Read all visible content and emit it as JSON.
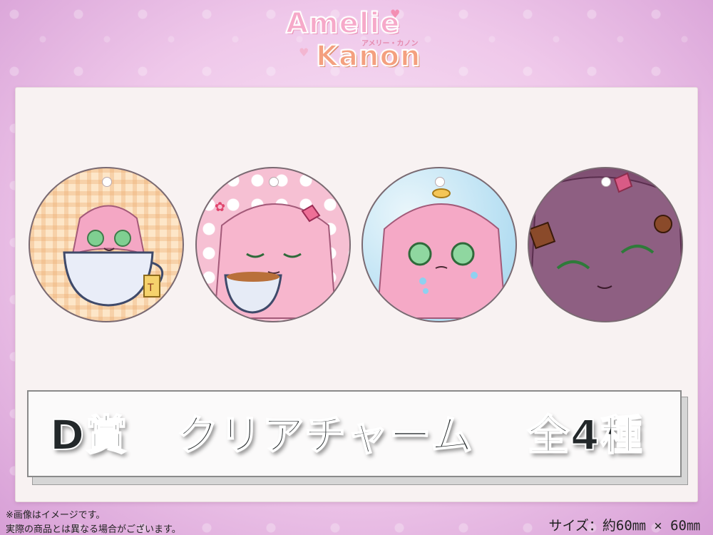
{
  "logo": {
    "line1": "Amelie",
    "line2": "Kanon",
    "kana": "アメリー・カノン"
  },
  "banner": {
    "prize": "D賞",
    "item": "クリアチャーム",
    "count": "全4種"
  },
  "notes": {
    "line1": "※画像はイメージです。",
    "line2": "実際の商品とは異なる場合がございます。"
  },
  "size": {
    "label": "サイズ：約60㎜ × 60㎜"
  },
  "colors": {
    "background": "#efc8ea",
    "panel": "#f8f2f2",
    "banner_text": "#23282a"
  },
  "charms": [
    {
      "name": "teacup-charm",
      "icon": "character-in-teacup"
    },
    {
      "name": "tea-drinking-charm",
      "icon": "character-holding-tea"
    },
    {
      "name": "teary-charm",
      "icon": "character-teary-eyes"
    },
    {
      "name": "closeup-charm",
      "icon": "character-closeup-smile"
    }
  ]
}
